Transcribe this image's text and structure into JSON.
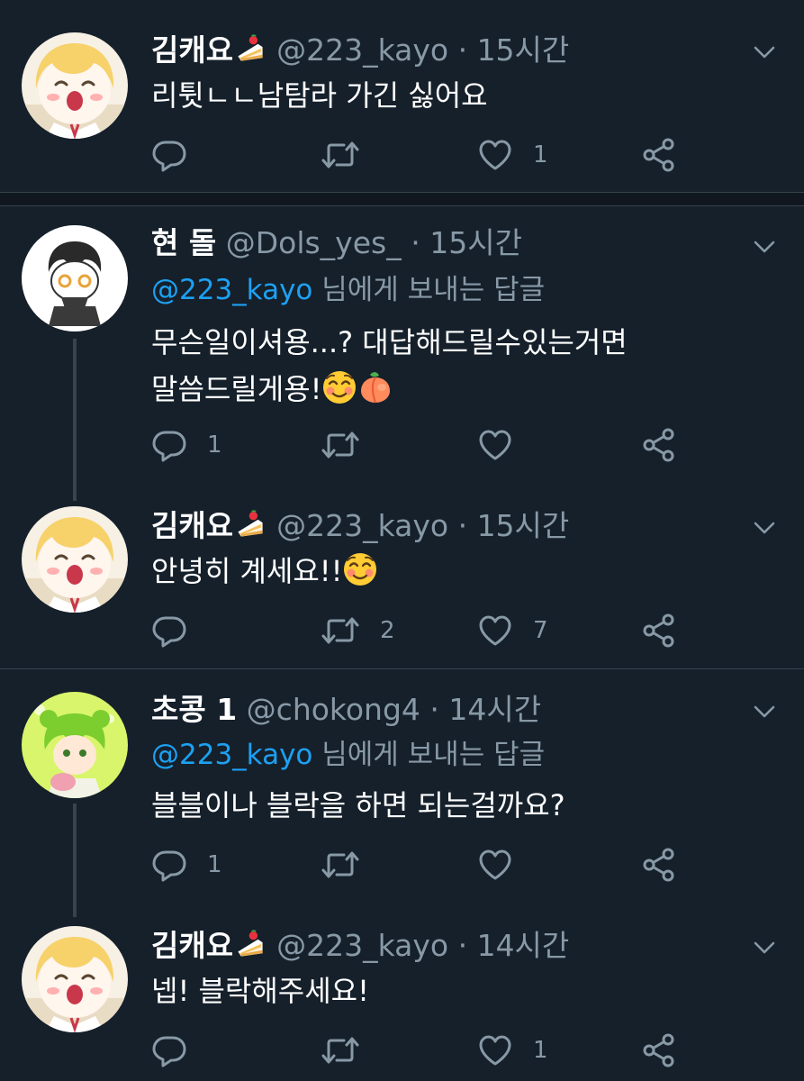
{
  "tweets": [
    {
      "display_name": "김캐요",
      "handle": "@223_kayo",
      "dot": "·",
      "time": "15시간",
      "reply_mention": "",
      "reply_suffix": "",
      "lines": [
        "리튓ㄴㄴ남탐라 가긴 싫어요"
      ],
      "reply_count": "",
      "retweet_count": "",
      "like_count": "1"
    },
    {
      "display_name": "현 돌",
      "handle": "@Dols_yes_",
      "dot": "·",
      "time": "15시간",
      "reply_mention": "@223_kayo",
      "reply_suffix": " 님에게 보내는 답글",
      "lines": [
        "무슨일이셔용...? 대답해드릴수있는거면",
        "말씀드릴게용!"
      ],
      "reply_count": "1",
      "retweet_count": "",
      "like_count": ""
    },
    {
      "display_name": "김캐요",
      "handle": "@223_kayo",
      "dot": "·",
      "time": "15시간",
      "reply_mention": "",
      "reply_suffix": "",
      "lines": [
        "안녕히 계세요!!"
      ],
      "reply_count": "",
      "retweet_count": "2",
      "like_count": "7"
    },
    {
      "display_name": "초콩 1",
      "handle": "@chokong4",
      "dot": "·",
      "time": "14시간",
      "reply_mention": "@223_kayo",
      "reply_suffix": " 님에게 보내는 답글",
      "lines": [
        "블블이나 블락을 하면 되는걸까요?"
      ],
      "reply_count": "1",
      "retweet_count": "",
      "like_count": ""
    },
    {
      "display_name": "김캐요",
      "handle": "@223_kayo",
      "dot": "·",
      "time": "14시간",
      "reply_mention": "",
      "reply_suffix": "",
      "lines": [
        "넵! 블락해주세요!"
      ],
      "reply_count": "",
      "retweet_count": "",
      "like_count": "1"
    }
  ],
  "icons": {
    "reply": "reply-icon",
    "retweet": "retweet-icon",
    "like": "heart-icon",
    "share": "share-icon",
    "more": "chevron-down-icon",
    "cake_emoji": "shortcake-emoji",
    "smile_emoji": "smiling-face-emoji",
    "peach_emoji": "peach-emoji"
  },
  "colors": {
    "background": "#15202b",
    "separator": "#10171e",
    "border": "#38444d",
    "text": "#ffffff",
    "muted": "#8899a6",
    "link": "#1da1f2"
  }
}
